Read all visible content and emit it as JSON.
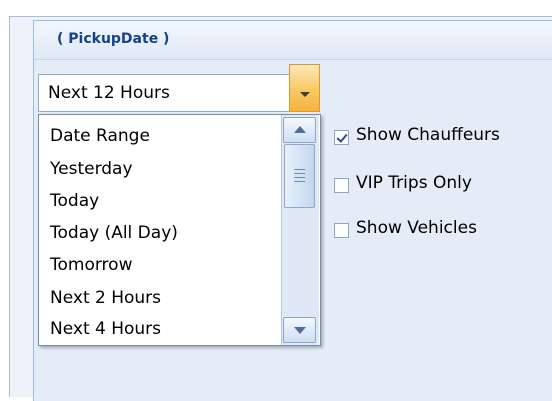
{
  "group": {
    "title": "( PickupDate )"
  },
  "combo": {
    "selected": "Next 12 Hours"
  },
  "dropdown": {
    "items": [
      "Date Range",
      "Yesterday",
      "Today",
      "Today (All Day)",
      "Tomorrow",
      "Next 2 Hours",
      "Next 4 Hours"
    ]
  },
  "options": {
    "show_chauffeurs": {
      "label": "Show Chauffeurs",
      "checked": true
    },
    "vip_trips_only": {
      "label": "VIP Trips Only",
      "checked": false
    },
    "show_vehicles": {
      "label": "Show Vehicles",
      "checked": false
    }
  },
  "colors": {
    "title": "#15428b",
    "combo_button": "#f9c864",
    "panel_background": "#e4ecf7"
  }
}
